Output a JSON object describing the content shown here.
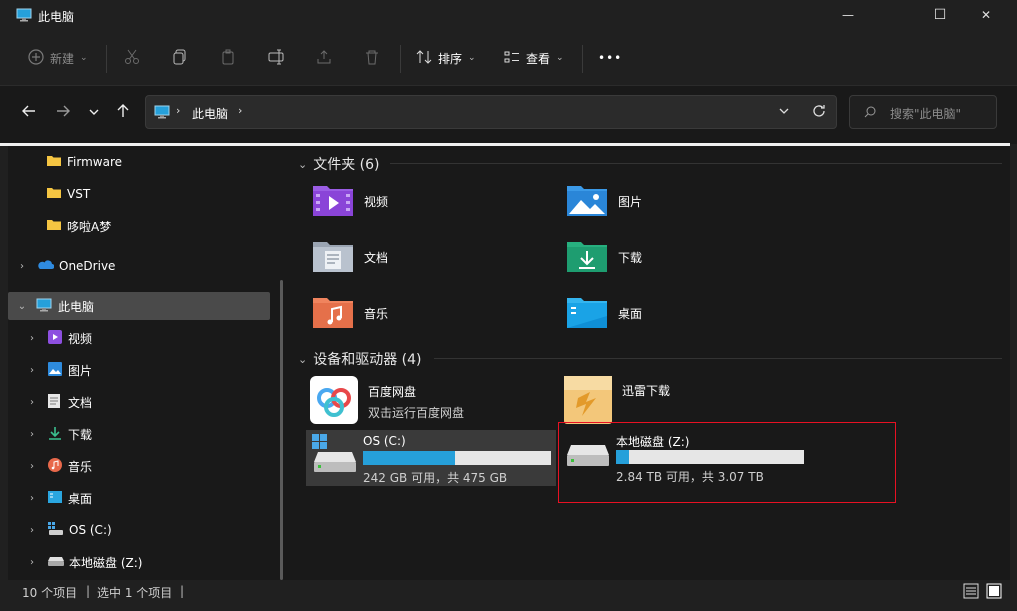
{
  "window": {
    "title": "此电脑",
    "minimize_glyph": "—",
    "maximize_glyph": "☐",
    "close_glyph": "✕"
  },
  "toolbar": {
    "new_label": "新建",
    "sort_label": "排序",
    "view_label": "查看",
    "more_glyph": "•••"
  },
  "address": {
    "path_root": "此电脑",
    "search_placeholder": "搜索\"此电脑\""
  },
  "sidebar": {
    "items": [
      {
        "label": "Firmware",
        "icon": "folder-icon"
      },
      {
        "label": "VST",
        "icon": "folder-icon"
      },
      {
        "label": "哆啦A梦",
        "icon": "folder-icon"
      },
      {
        "label": "OneDrive",
        "icon": "onedrive-icon"
      },
      {
        "label": "此电脑",
        "icon": "computer-icon"
      },
      {
        "label": "视频",
        "icon": "video-icon"
      },
      {
        "label": "图片",
        "icon": "pictures-icon"
      },
      {
        "label": "文档",
        "icon": "documents-icon"
      },
      {
        "label": "下载",
        "icon": "download-icon"
      },
      {
        "label": "音乐",
        "icon": "music-icon"
      },
      {
        "label": "桌面",
        "icon": "desktop-icon"
      },
      {
        "label": "OS (C:)",
        "icon": "os-drive-icon"
      },
      {
        "label": "本地磁盘 (Z:)",
        "icon": "drive-icon"
      }
    ]
  },
  "folders": {
    "header": "文件夹 (6)",
    "items": [
      {
        "label": "视频",
        "icon": "video-folder-icon"
      },
      {
        "label": "图片",
        "icon": "pictures-folder-icon"
      },
      {
        "label": "文档",
        "icon": "documents-folder-icon"
      },
      {
        "label": "下载",
        "icon": "downloads-folder-icon"
      },
      {
        "label": "音乐",
        "icon": "music-folder-icon"
      },
      {
        "label": "桌面",
        "icon": "desktop-folder-icon"
      }
    ]
  },
  "devices": {
    "header": "设备和驱动器 (4)",
    "apps": [
      {
        "name": "百度网盘",
        "sub": "双击运行百度网盘",
        "icon": "baidu-netdisk-icon"
      },
      {
        "name": "迅雷下载",
        "sub": "",
        "icon": "xunlei-icon"
      }
    ],
    "drives": [
      {
        "name": "OS (C:)",
        "info": "242 GB 可用，共 475 GB",
        "used_fraction": 0.49
      },
      {
        "name": "本地磁盘 (Z:)",
        "info": "2.84 TB 可用，共 3.07 TB",
        "used_fraction": 0.07
      }
    ]
  },
  "status": {
    "item_count": "10 个项目",
    "selected": "选中 1 个项目"
  },
  "colors": {
    "accent": "#26a0da",
    "selection_outline": "#e81123"
  }
}
